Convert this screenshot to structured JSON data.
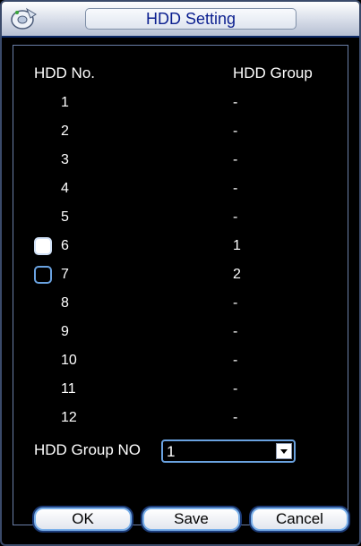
{
  "window": {
    "title": "HDD Setting"
  },
  "columns": {
    "hdd_no": "HDD No.",
    "hdd_group": "HDD Group"
  },
  "rows": [
    {
      "no": "1",
      "group": "-",
      "checkbox": false
    },
    {
      "no": "2",
      "group": "-",
      "checkbox": false
    },
    {
      "no": "3",
      "group": "-",
      "checkbox": false
    },
    {
      "no": "4",
      "group": "-",
      "checkbox": false
    },
    {
      "no": "5",
      "group": "-",
      "checkbox": false
    },
    {
      "no": "6",
      "group": "1",
      "checkbox": true,
      "checked": true
    },
    {
      "no": "7",
      "group": "2",
      "checkbox": true,
      "checked": false
    },
    {
      "no": "8",
      "group": "-",
      "checkbox": false
    },
    {
      "no": "9",
      "group": "-",
      "checkbox": false
    },
    {
      "no": "10",
      "group": "-",
      "checkbox": false
    },
    {
      "no": "11",
      "group": "-",
      "checkbox": false
    },
    {
      "no": "12",
      "group": "-",
      "checkbox": false
    }
  ],
  "group_select": {
    "label": "HDD Group NO",
    "value": "1"
  },
  "buttons": {
    "ok": "OK",
    "save": "Save",
    "cancel": "Cancel"
  },
  "icons": {
    "app": "disk-app-icon",
    "dropdown": "chevron-down-icon"
  },
  "colors": {
    "title_text": "#0b1f8f",
    "accent_border": "#6aa2e0",
    "background": "#000000"
  }
}
